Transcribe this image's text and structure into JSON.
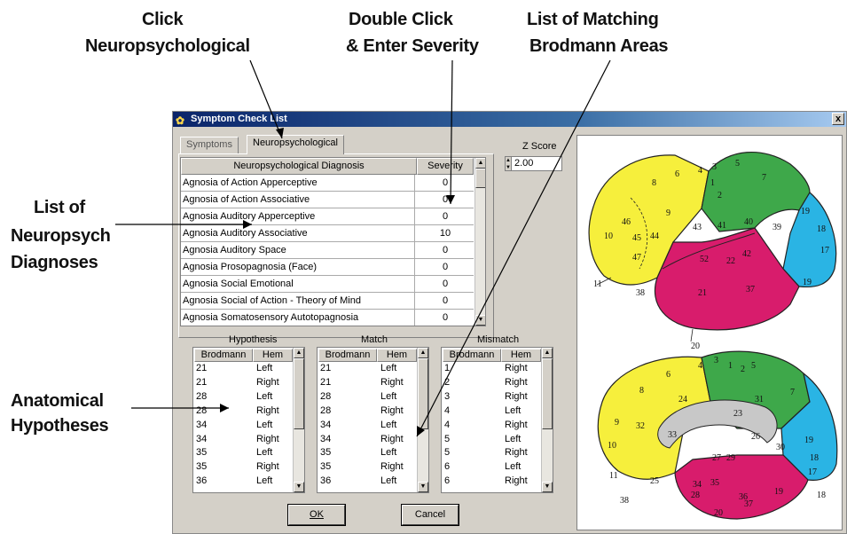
{
  "annotations": {
    "click_neuro": [
      "Click",
      "Neuropsychological"
    ],
    "double_click": [
      "Double Click",
      "& Enter Severity"
    ],
    "list_matching": [
      "List of Matching",
      "Brodmann Areas"
    ],
    "list_neuropsych": [
      "List of",
      "Neuropsych",
      "Diagnoses"
    ],
    "anatomical": [
      "Anatomical",
      "Hypotheses"
    ]
  },
  "window": {
    "title": "Symptom Check List",
    "close": "x",
    "tabs": [
      "Symptoms",
      "Neuropsychological"
    ],
    "zscore_label": "Z Score",
    "zscore_value": "2.00"
  },
  "grid": {
    "headers": [
      "Neuropsychological Diagnosis",
      "Severity"
    ],
    "rows": [
      {
        "diagnosis": "Agnosia of Action Apperceptive",
        "severity": "0"
      },
      {
        "diagnosis": "Agnosia of Action Associative",
        "severity": "0"
      },
      {
        "diagnosis": "Agnosia Auditory Apperceptive",
        "severity": "0"
      },
      {
        "diagnosis": "Agnosia Auditory Associative",
        "severity": "10"
      },
      {
        "diagnosis": "Agnosia Auditory Space",
        "severity": "0"
      },
      {
        "diagnosis": "Agnosia Prosopagnosia (Face)",
        "severity": "0"
      },
      {
        "diagnosis": "Agnosia Social Emotional",
        "severity": "0"
      },
      {
        "diagnosis": "Agnosia Social of Action - Theory of Mind",
        "severity": "0"
      },
      {
        "diagnosis": "Agnosia Somatosensory Autotopagnosia",
        "severity": "0"
      }
    ]
  },
  "lists": [
    {
      "title": "Hypothesis",
      "headers": [
        "Brodmann",
        "Hem"
      ],
      "rows": [
        [
          "21",
          "Left"
        ],
        [
          "21",
          "Right"
        ],
        [
          "28",
          "Left"
        ],
        [
          "28",
          "Right"
        ],
        [
          "34",
          "Left"
        ],
        [
          "34",
          "Right"
        ],
        [
          "35",
          "Left"
        ],
        [
          "35",
          "Right"
        ],
        [
          "36",
          "Left"
        ]
      ]
    },
    {
      "title": "Match",
      "headers": [
        "Brodmann",
        "Hem"
      ],
      "rows": [
        [
          "21",
          "Left"
        ],
        [
          "21",
          "Right"
        ],
        [
          "28",
          "Left"
        ],
        [
          "28",
          "Right"
        ],
        [
          "34",
          "Left"
        ],
        [
          "34",
          "Right"
        ],
        [
          "35",
          "Left"
        ],
        [
          "35",
          "Right"
        ],
        [
          "36",
          "Left"
        ]
      ]
    },
    {
      "title": "Mismatch",
      "headers": [
        "Brodmann",
        "Hem"
      ],
      "rows": [
        [
          "1",
          "Right"
        ],
        [
          "2",
          "Right"
        ],
        [
          "3",
          "Right"
        ],
        [
          "4",
          "Left"
        ],
        [
          "4",
          "Right"
        ],
        [
          "5",
          "Left"
        ],
        [
          "5",
          "Right"
        ],
        [
          "6",
          "Left"
        ],
        [
          "6",
          "Right"
        ]
      ]
    }
  ],
  "buttons": {
    "ok": "OK",
    "cancel": "Cancel"
  },
  "brain": {
    "lateral_labels": [
      "8",
      "6",
      "4",
      "3",
      "1",
      "2",
      "5",
      "7",
      "9",
      "46",
      "10",
      "45",
      "44",
      "43",
      "41",
      "40",
      "39",
      "19",
      "18",
      "17",
      "47",
      "52",
      "22",
      "42",
      "11",
      "38",
      "21",
      "37",
      "19",
      "20"
    ],
    "medial_labels": [
      "6",
      "4",
      "3",
      "1",
      "2",
      "5",
      "8",
      "24",
      "31",
      "7",
      "9",
      "32",
      "33",
      "23",
      "10",
      "26",
      "30",
      "19",
      "18",
      "27",
      "29",
      "17",
      "11",
      "25",
      "34",
      "35",
      "28",
      "36",
      "38",
      "37",
      "19",
      "18",
      "20"
    ],
    "colors": {
      "yellow": "#f6ef3c",
      "green": "#3ea84a",
      "blue": "#2ab4e4",
      "magenta": "#d81c6c",
      "gray": "#c8c8c8"
    }
  }
}
